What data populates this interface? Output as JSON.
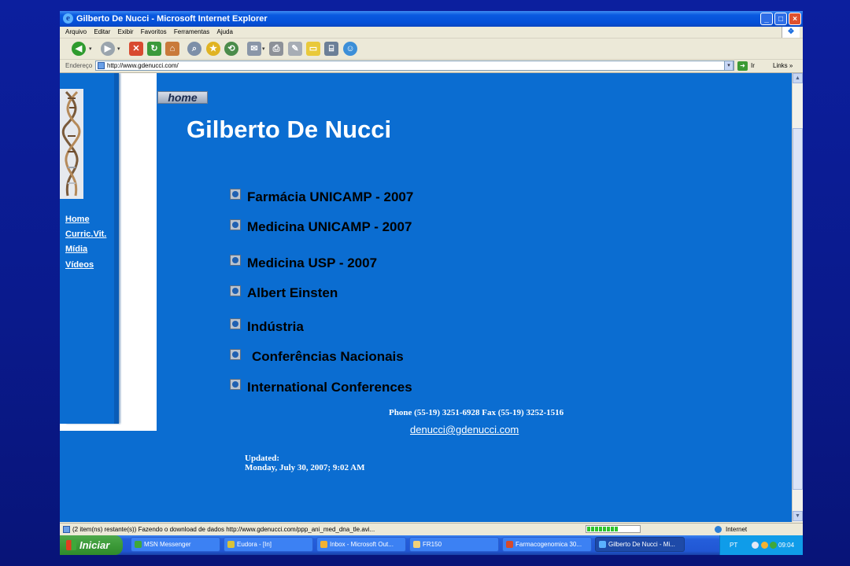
{
  "window": {
    "title": "Gilberto De Nucci - Microsoft Internet Explorer",
    "app_icon": "ie-icon",
    "controls": {
      "minimize": "_",
      "maximize": "□",
      "close": "×"
    }
  },
  "menu": {
    "items": [
      "Arquivo",
      "Editar",
      "Exibir",
      "Favoritos",
      "Ferramentas",
      "Ajuda"
    ]
  },
  "toolbar": {
    "back_glyph": "◀",
    "forward_glyph": "▶",
    "stop_glyph": "✕",
    "refresh_glyph": "↻",
    "home_glyph": "⌂",
    "search_glyph": "⌕",
    "favorites_glyph": "★",
    "history_glyph": "⟲",
    "mail_glyph": "✉",
    "print_glyph": "⎙",
    "edit_glyph": "✎",
    "folder_glyph": "▭",
    "research_glyph": "⌸",
    "messenger_glyph": "☺",
    "dropdown_glyph": "▾"
  },
  "address": {
    "label": "Endereço",
    "url": "http://www.gdenucci.com/",
    "dropdown_glyph": "▾",
    "go_glyph": "➜",
    "go_label": "Ir",
    "links_label": "Links",
    "links_more": "»"
  },
  "sidebar": {
    "nav": [
      "Home",
      "Curric.Vit.",
      "Mídia",
      "Vídeos"
    ]
  },
  "page": {
    "home_tab": "home",
    "title": "Gilberto De Nucci",
    "links": [
      "Farmácia UNICAMP - 2007",
      "Medicina UNICAMP - 2007",
      "Medicina USP - 2007",
      "Albert Einsten",
      "Indústria",
      "Conferências Nacionais",
      "International Conferences"
    ],
    "contact": "Phone (55-19) 3251-6928   Fax (55-19) 3252-1516",
    "email": "denucci@gdenucci.com",
    "updated_label": "Updated:",
    "updated_date": "Monday, July 30, 2007;  9:02 AM"
  },
  "scrollbar": {
    "up_glyph": "▲",
    "down_glyph": "▼"
  },
  "status": {
    "text": "(2 item(ns) restante(s)) Fazendo o download de dados http://www.gdenucci.com/ppp_ani_med_dna_tle.avi...",
    "progress": 0.6,
    "zone": "Internet"
  },
  "taskbar": {
    "start_label": "Iniciar",
    "tasks": [
      {
        "label": "MSN Messenger",
        "icon_color": "#3fa83a"
      },
      {
        "label": "Eudora - [In]",
        "icon_color": "#d9c23a"
      },
      {
        "label": "Inbox - Microsoft Out...",
        "icon_color": "#f2b233"
      },
      {
        "label": "FR150",
        "icon_color": "#f2d27a"
      },
      {
        "label": "Farmacogenomica 30...",
        "icon_color": "#d64a2b"
      },
      {
        "label": "Gilberto De Nucci - Mi...",
        "icon_color": "#5ab1ff"
      }
    ],
    "language": "PT",
    "clock": "09:04"
  },
  "colors": {
    "page_bg": "#0b6dd1",
    "desktop_bg": "#0a1a8c",
    "link_text": "#000000",
    "title_text": "#ffffff"
  }
}
